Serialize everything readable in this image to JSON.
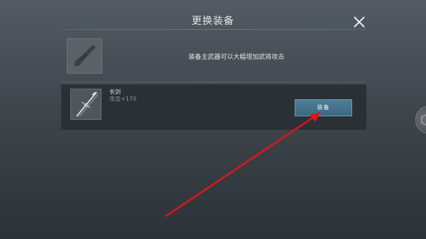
{
  "dialog": {
    "title": "更换装备",
    "tip": "装备主武器可以大幅增加武将攻击"
  },
  "icons": {
    "close": "close-icon",
    "empty_slot": "weapon-silhouette-icon",
    "item": "sword-icon",
    "side": "side-round-button-icon"
  },
  "item": {
    "name": "长剑",
    "stat": "攻击+170",
    "equip_label": "装备"
  },
  "colors": {
    "button": "#3f6d88",
    "annotation_arrow": "#e0141a"
  }
}
